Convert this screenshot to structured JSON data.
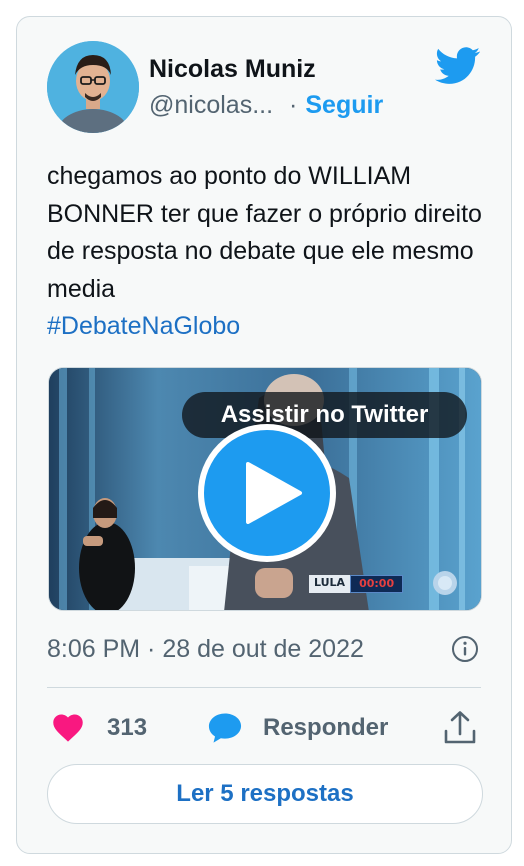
{
  "tweet": {
    "author": {
      "display_name": "Nicolas Muniz",
      "handle": "@nicolas...",
      "follow_label": "Seguir",
      "separator": "·"
    },
    "text": "chegamos ao ponto do WILLIAM BONNER ter que fazer o próprio direito de resposta no debate que ele mesmo media",
    "hashtag": "#DebateNaGlobo",
    "media": {
      "watch_label": "Assistir no Twitter",
      "name_tag": "LULA",
      "timer": "00:00"
    },
    "timestamp": "8:06 PM · 28 de out de 2022",
    "likes": "313",
    "reply_label": "Responder",
    "read_replies_label": "Ler 5 respostas"
  },
  "colors": {
    "brand": "#1d9bf0",
    "like": "#f91880",
    "text": "#0f1419",
    "muted": "#536471",
    "border": "#cfd9de"
  },
  "icons": [
    "twitter-bird-icon",
    "play-icon",
    "info-icon",
    "heart-icon",
    "reply-bubble-icon",
    "share-icon"
  ]
}
